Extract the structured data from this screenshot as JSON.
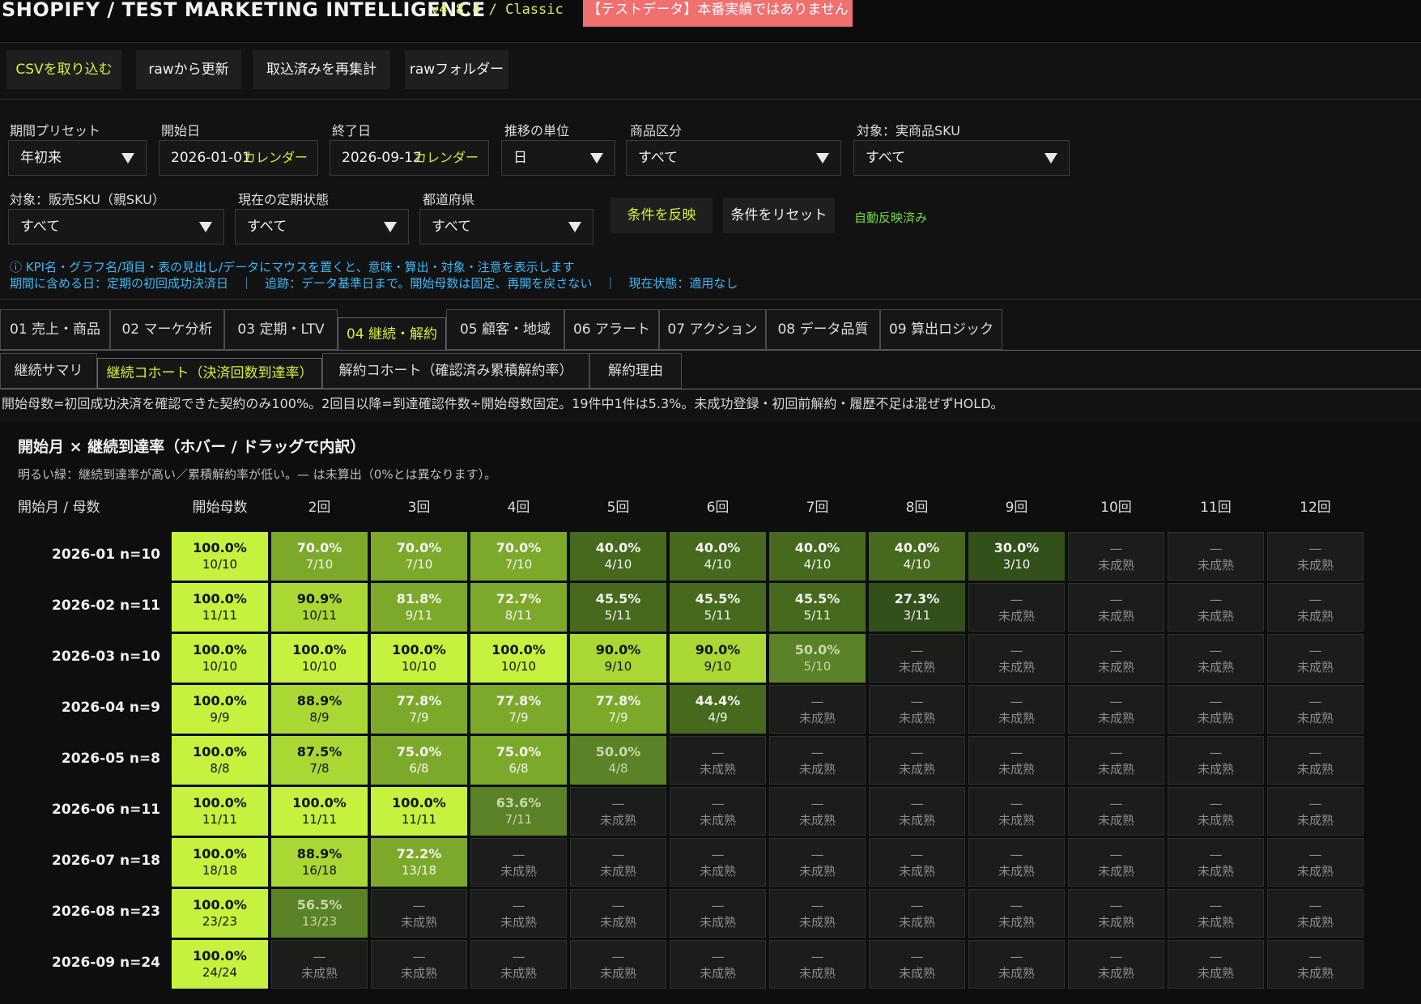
{
  "app": {
    "title": "SHOPIFY / TEST MARKETING INTELLIGENCE",
    "version": "v4.8.4 / Classic",
    "warning_badge": "【テストデータ】本番実績ではありません"
  },
  "toolbar": {
    "import_csv": "CSVを取り込む",
    "update_from_raw": "rawから更新",
    "reaggregate": "取込済みを再集計",
    "raw_folder": "rawフォルダー"
  },
  "filters": {
    "period_preset": {
      "label": "期間プリセット",
      "value": "年初来"
    },
    "start_date": {
      "label": "開始日",
      "value": "2026-01-01",
      "calendar": "カレンダー"
    },
    "end_date": {
      "label": "終了日",
      "value": "2026-09-12",
      "calendar": "カレンダー"
    },
    "trend_unit": {
      "label": "推移の単位",
      "value": "日"
    },
    "product_category": {
      "label": "商品区分",
      "value": "すべて"
    },
    "target_sku": {
      "label": "対象：実商品SKU",
      "value": "すべて"
    },
    "sales_sku": {
      "label": "対象：販売SKU（親SKU）",
      "value": "すべて"
    },
    "subscription_status": {
      "label": "現在の定期状態",
      "value": "すべて"
    },
    "prefecture": {
      "label": "都道府県",
      "value": "すべて"
    },
    "apply_button": "条件を反映",
    "reset_button": "条件をリセット",
    "auto_applied": "自動反映済み"
  },
  "info": {
    "line1": "ⓘ KPI名・グラフ名/項目・表の見出し/データにマウスを置くと、意味・算出・対象・注意を表示します",
    "line2": "期間に含める日：定期の初回成功決済日　｜　追跡：データ基準日まで。開始母数は固定、再開を戻さない　｜　現在状態：適用なし"
  },
  "tabs": [
    {
      "label": "01 売上・商品"
    },
    {
      "label": "02 マーケ分析"
    },
    {
      "label": "03 定期・LTV"
    },
    {
      "label": "04 継続・解約"
    },
    {
      "label": "05 顧客・地域"
    },
    {
      "label": "06 アラート"
    },
    {
      "label": "07 アクション"
    },
    {
      "label": "08 データ品質"
    },
    {
      "label": "09 算出ロジック"
    }
  ],
  "active_tab": 3,
  "subtabs": [
    {
      "label": "継続サマリ"
    },
    {
      "label": "継続コホート（決済回数到達率）"
    },
    {
      "label": "解約コホート（確認済み累積解約率）"
    },
    {
      "label": "解約理由"
    }
  ],
  "active_subtab": 1,
  "note": "開始母数=初回成功決済を確認できた契約のみ100%。2回目以降=到達確認件数÷開始母数固定。19件中1件は5.3%。未成功登録・初回前解約・履歴不足は混ぜずHOLD。",
  "cohort": {
    "title": "開始月 × 継続到達率（ホバー / ドラッグで内訳）",
    "subtitle": "明るい緑：継続到達率が高い／累積解約率が低い。— は未算出（0%とは異なります）。",
    "row_header_label": "開始月 / 母数",
    "columns": [
      "開始母数",
      "2回",
      "3回",
      "4回",
      "5回",
      "6回",
      "7回",
      "8回",
      "9回",
      "10回",
      "11回",
      "12回"
    ],
    "immature_dash": "—",
    "immature_label": "未成熟",
    "colors": {
      "high": "#c5f23e",
      "high_mid": "#a9d835",
      "mid": "#7da92a",
      "low_mid": "#5b8226",
      "low": "#46691e",
      "lowest": "#33501a",
      "immature": "#1b1d1b"
    },
    "rows": [
      {
        "label": "2026-01 n=10",
        "cells": [
          {
            "pct": "100.0%",
            "count": "10/10",
            "level": "high"
          },
          {
            "pct": "70.0%",
            "count": "7/10",
            "level": "mid"
          },
          {
            "pct": "70.0%",
            "count": "7/10",
            "level": "mid"
          },
          {
            "pct": "70.0%",
            "count": "7/10",
            "level": "mid"
          },
          {
            "pct": "40.0%",
            "count": "4/10",
            "level": "low"
          },
          {
            "pct": "40.0%",
            "count": "4/10",
            "level": "low"
          },
          {
            "pct": "40.0%",
            "count": "4/10",
            "level": "low"
          },
          {
            "pct": "40.0%",
            "count": "4/10",
            "level": "low"
          },
          {
            "pct": "30.0%",
            "count": "3/10",
            "level": "lowest"
          },
          null,
          null,
          null
        ]
      },
      {
        "label": "2026-02 n=11",
        "cells": [
          {
            "pct": "100.0%",
            "count": "11/11",
            "level": "high"
          },
          {
            "pct": "90.9%",
            "count": "10/11",
            "level": "high_mid"
          },
          {
            "pct": "81.8%",
            "count": "9/11",
            "level": "mid"
          },
          {
            "pct": "72.7%",
            "count": "8/11",
            "level": "mid"
          },
          {
            "pct": "45.5%",
            "count": "5/11",
            "level": "low"
          },
          {
            "pct": "45.5%",
            "count": "5/11",
            "level": "low"
          },
          {
            "pct": "45.5%",
            "count": "5/11",
            "level": "low"
          },
          {
            "pct": "27.3%",
            "count": "3/11",
            "level": "lowest"
          },
          null,
          null,
          null,
          null
        ]
      },
      {
        "label": "2026-03 n=10",
        "cells": [
          {
            "pct": "100.0%",
            "count": "10/10",
            "level": "high"
          },
          {
            "pct": "100.0%",
            "count": "10/10",
            "level": "high"
          },
          {
            "pct": "100.0%",
            "count": "10/10",
            "level": "high"
          },
          {
            "pct": "100.0%",
            "count": "10/10",
            "level": "high"
          },
          {
            "pct": "90.0%",
            "count": "9/10",
            "level": "high_mid"
          },
          {
            "pct": "90.0%",
            "count": "9/10",
            "level": "high_mid"
          },
          {
            "pct": "50.0%",
            "count": "5/10",
            "level": "low_mid"
          },
          null,
          null,
          null,
          null,
          null
        ]
      },
      {
        "label": "2026-04 n=9",
        "cells": [
          {
            "pct": "100.0%",
            "count": "9/9",
            "level": "high"
          },
          {
            "pct": "88.9%",
            "count": "8/9",
            "level": "high_mid"
          },
          {
            "pct": "77.8%",
            "count": "7/9",
            "level": "mid"
          },
          {
            "pct": "77.8%",
            "count": "7/9",
            "level": "mid"
          },
          {
            "pct": "77.8%",
            "count": "7/9",
            "level": "mid"
          },
          {
            "pct": "44.4%",
            "count": "4/9",
            "level": "low"
          },
          null,
          null,
          null,
          null,
          null,
          null
        ]
      },
      {
        "label": "2026-05 n=8",
        "cells": [
          {
            "pct": "100.0%",
            "count": "8/8",
            "level": "high"
          },
          {
            "pct": "87.5%",
            "count": "7/8",
            "level": "high_mid"
          },
          {
            "pct": "75.0%",
            "count": "6/8",
            "level": "mid"
          },
          {
            "pct": "75.0%",
            "count": "6/8",
            "level": "mid"
          },
          {
            "pct": "50.0%",
            "count": "4/8",
            "level": "low_mid"
          },
          null,
          null,
          null,
          null,
          null,
          null,
          null
        ]
      },
      {
        "label": "2026-06 n=11",
        "cells": [
          {
            "pct": "100.0%",
            "count": "11/11",
            "level": "high"
          },
          {
            "pct": "100.0%",
            "count": "11/11",
            "level": "high"
          },
          {
            "pct": "100.0%",
            "count": "11/11",
            "level": "high"
          },
          {
            "pct": "63.6%",
            "count": "7/11",
            "level": "low_mid"
          },
          null,
          null,
          null,
          null,
          null,
          null,
          null,
          null
        ]
      },
      {
        "label": "2026-07 n=18",
        "cells": [
          {
            "pct": "100.0%",
            "count": "18/18",
            "level": "high"
          },
          {
            "pct": "88.9%",
            "count": "16/18",
            "level": "high_mid"
          },
          {
            "pct": "72.2%",
            "count": "13/18",
            "level": "mid"
          },
          null,
          null,
          null,
          null,
          null,
          null,
          null,
          null,
          null
        ]
      },
      {
        "label": "2026-08 n=23",
        "cells": [
          {
            "pct": "100.0%",
            "count": "23/23",
            "level": "high"
          },
          {
            "pct": "56.5%",
            "count": "13/23",
            "level": "low_mid"
          },
          null,
          null,
          null,
          null,
          null,
          null,
          null,
          null,
          null,
          null
        ]
      },
      {
        "label": "2026-09 n=24",
        "cells": [
          {
            "pct": "100.0%",
            "count": "24/24",
            "level": "high"
          },
          null,
          null,
          null,
          null,
          null,
          null,
          null,
          null,
          null,
          null,
          null
        ]
      }
    ]
  }
}
